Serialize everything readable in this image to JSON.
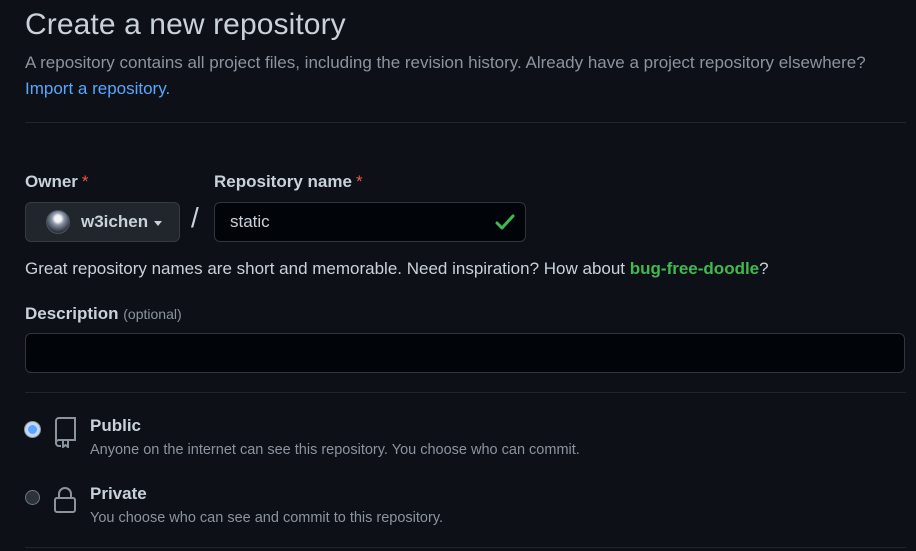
{
  "header": {
    "title": "Create a new repository",
    "subtitle": "A repository contains all project files, including the revision history. Already have a project repository elsewhere?",
    "import_link": "Import a repository."
  },
  "owner": {
    "label": "Owner",
    "required_mark": "*",
    "value": "w3ichen"
  },
  "separator": "/",
  "repo_name": {
    "label": "Repository name",
    "required_mark": "*",
    "value": "static",
    "valid": true
  },
  "hint": {
    "text": "Great repository names are short and memorable. Need inspiration? How about ",
    "suggestion": "bug-free-doodle",
    "suffix": "?"
  },
  "description": {
    "label": "Description",
    "optional": "(optional)",
    "value": ""
  },
  "visibility": {
    "selected": "public",
    "options": [
      {
        "id": "public",
        "title": "Public",
        "desc": "Anyone on the internet can see this repository. You choose who can commit.",
        "icon": "repo-icon"
      },
      {
        "id": "private",
        "title": "Private",
        "desc": "You choose who can see and commit to this repository.",
        "icon": "lock-icon"
      }
    ]
  },
  "colors": {
    "background": "#0d1117",
    "link": "#58a6ff",
    "success": "#3fb950",
    "required": "#f85149"
  }
}
